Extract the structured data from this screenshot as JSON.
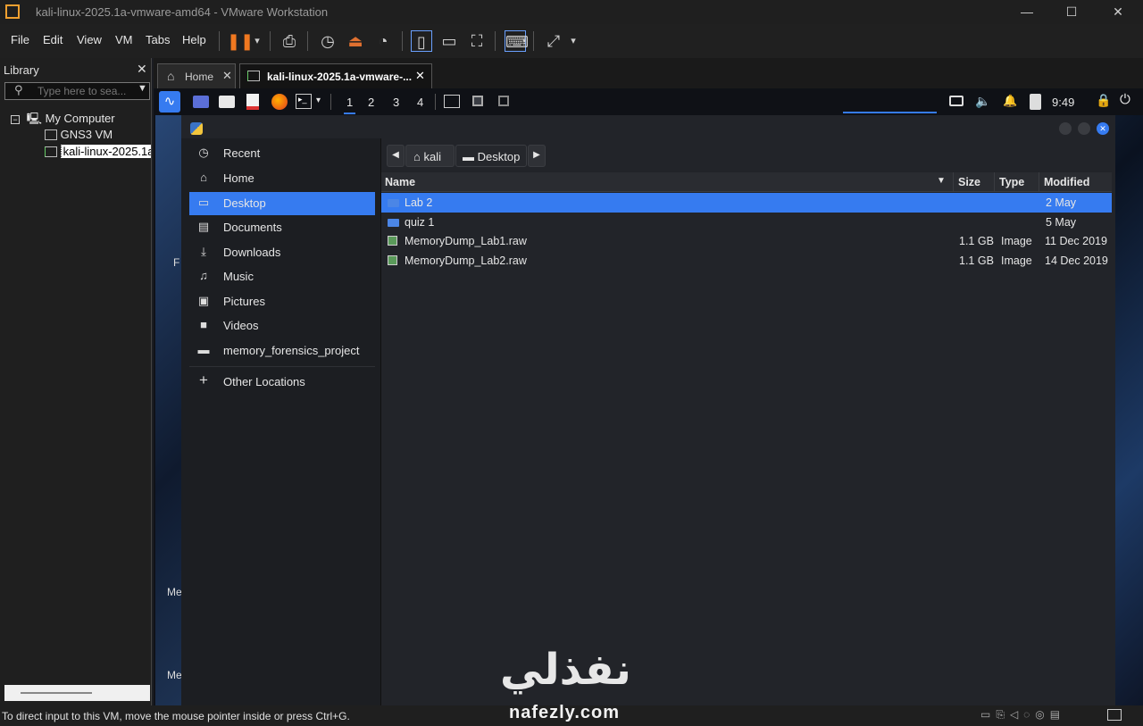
{
  "window": {
    "title": "kali-linux-2025.1a-vmware-amd64 - VMware Workstation",
    "minimize": "—",
    "maximize": "☐",
    "close": "✕"
  },
  "menu": [
    "File",
    "Edit",
    "View",
    "VM",
    "Tabs",
    "Help"
  ],
  "library": {
    "title": "Library",
    "close": "✕",
    "search_placeholder": "Type here to sea...",
    "tree": [
      {
        "label": "My Computer"
      },
      {
        "label": "GNS3 VM"
      },
      {
        "label": "kali-linux-2025.1a"
      }
    ]
  },
  "tabs": [
    {
      "label": "Home"
    },
    {
      "label": "kali-linux-2025.1a-vmware-..."
    }
  ],
  "panel": {
    "workspaces": [
      "1",
      "2",
      "3",
      "4"
    ],
    "clock": "9:49"
  },
  "sidebar": {
    "items": [
      {
        "label": "Recent",
        "icon": "clock-icon",
        "glyph": "◷"
      },
      {
        "label": "Home",
        "icon": "home-icon",
        "glyph": "⌂"
      },
      {
        "label": "Desktop",
        "icon": "desktop-icon",
        "glyph": "▭"
      },
      {
        "label": "Documents",
        "icon": "document-icon",
        "glyph": "▤"
      },
      {
        "label": "Downloads",
        "icon": "download-icon",
        "glyph": "⤓"
      },
      {
        "label": "Music",
        "icon": "music-icon",
        "glyph": "♫"
      },
      {
        "label": "Pictures",
        "icon": "picture-icon",
        "glyph": "▣"
      },
      {
        "label": "Videos",
        "icon": "video-icon",
        "glyph": "■"
      },
      {
        "label": "memory_forensics_project",
        "icon": "folder-icon",
        "glyph": "▬"
      },
      {
        "label": "Other Locations",
        "icon": "plus-icon",
        "glyph": "+"
      }
    ]
  },
  "breadcrumb": [
    "kali",
    "Desktop"
  ],
  "columns": {
    "name": "Name",
    "size": "Size",
    "type": "Type",
    "modified": "Modified"
  },
  "files": [
    {
      "name": "Lab 2",
      "size": "",
      "type": "",
      "modified": "2 May",
      "kind": "folder"
    },
    {
      "name": "quiz 1",
      "size": "",
      "type": "",
      "modified": "5 May",
      "kind": "folder"
    },
    {
      "name": "MemoryDump_Lab1.raw",
      "size": "1.1 GB",
      "type": "Image",
      "modified": "11 Dec 2019",
      "kind": "file"
    },
    {
      "name": "MemoryDump_Lab2.raw",
      "size": "1.1 GB",
      "type": "Image",
      "modified": "14 Dec 2019",
      "kind": "file"
    }
  ],
  "desktop_fragments": [
    "F",
    "Me",
    "Me"
  ],
  "status": "To direct input to this VM, move the mouse pointer inside or press Ctrl+G.",
  "watermark": {
    "arabic": "نفذلي",
    "latin": "nafezly.com"
  }
}
